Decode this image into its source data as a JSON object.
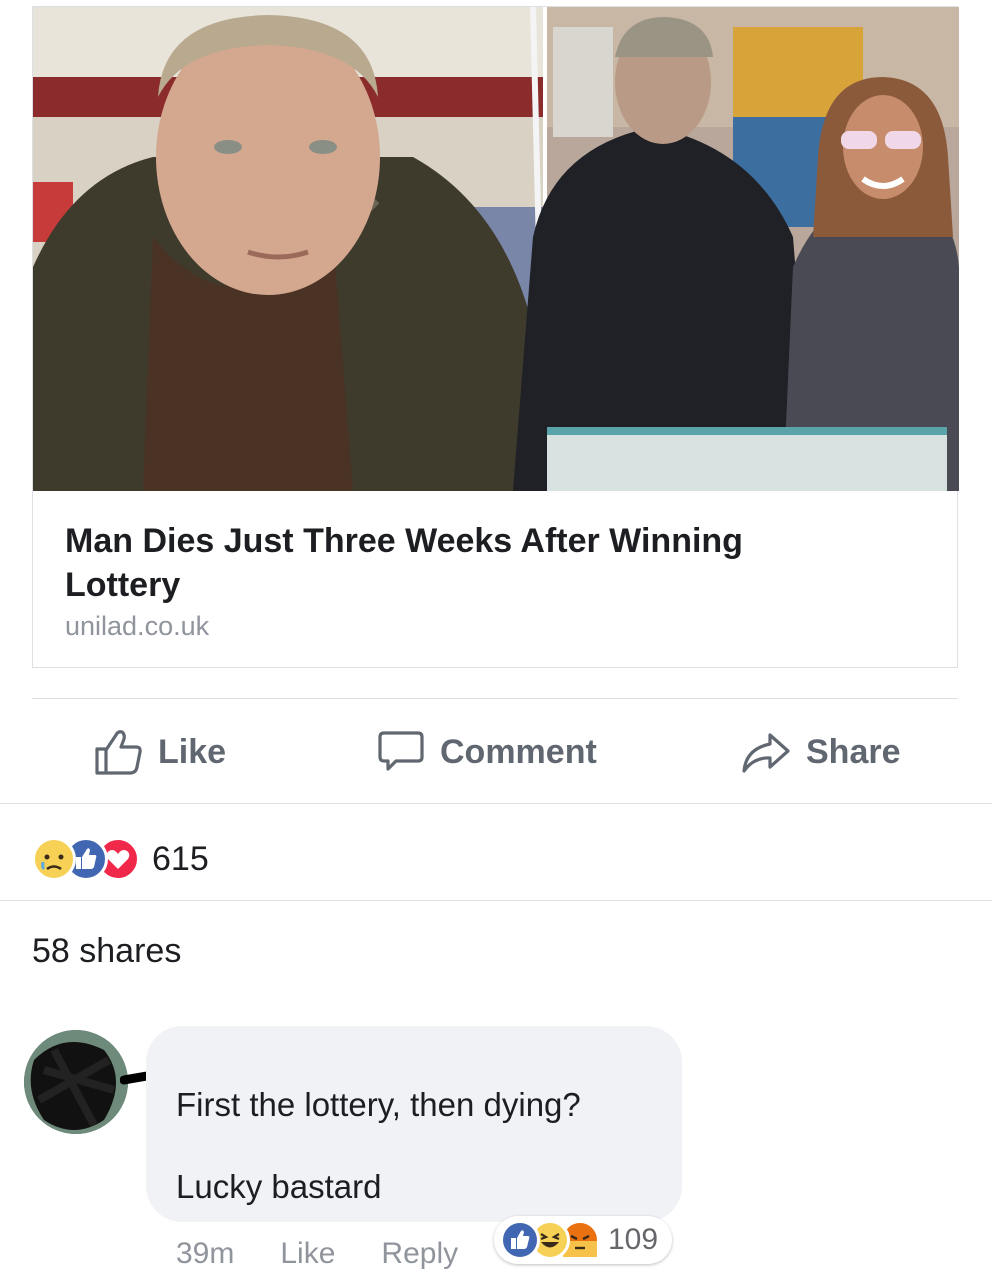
{
  "post": {
    "link_title": "Man Dies Just Three Weeks After Winning Lottery",
    "link_domain": "unilad.co.uk"
  },
  "actions": {
    "like_label": "Like",
    "comment_label": "Comment",
    "share_label": "Share"
  },
  "reactions": {
    "types": [
      "sad",
      "like",
      "love"
    ],
    "count": "615"
  },
  "shares_text": "58 shares",
  "comment": {
    "text_line1": "First the lottery, then dying?",
    "text_line2": "Lucky bastard",
    "time": "39m",
    "like_label": "Like",
    "reply_label": "Reply",
    "reaction_types": [
      "like",
      "haha",
      "angry"
    ],
    "reaction_count": "109"
  },
  "colors": {
    "like_blue": "#4267b2",
    "love_red": "#f0284a",
    "sad_yellow": "#f7d155",
    "angry_orange": "#e9710f",
    "muted_text": "#90949c",
    "icon_gray": "#606770"
  }
}
